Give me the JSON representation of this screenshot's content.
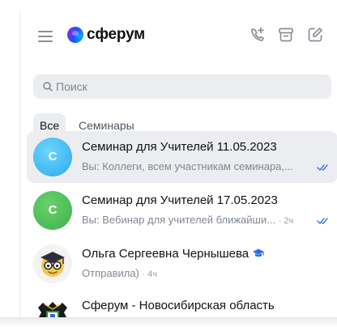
{
  "header": {
    "logo_text": "сферум",
    "brand_color": "#2a5cff"
  },
  "icons": {
    "menu": "hamburger-menu-icon",
    "call": "phone-plus-icon",
    "archive": "archive-icon",
    "compose": "compose-icon",
    "search": "search-icon",
    "read": "double-check-icon",
    "verified": "graduation-cap-icon"
  },
  "search": {
    "placeholder": "Поиск",
    "value": ""
  },
  "tabs": [
    {
      "label": "Все",
      "selected": true
    },
    {
      "label": "Семинары",
      "selected": false
    }
  ],
  "chats": [
    {
      "avatar_letter": "С",
      "title": "Семинар для Учителей 11.05.2023",
      "sender": "Вы:",
      "preview": "Коллеги, всем участникам семинара,...",
      "time": "",
      "read": true,
      "active": true
    },
    {
      "avatar_letter": "С",
      "title": "Семинар для Учителей 17.05.2023",
      "sender": "Вы:",
      "preview": "Вебинар для учителей ближайши...",
      "time": "· 2ч",
      "read": true,
      "active": false
    },
    {
      "title": "Ольга Сергеевна Чернышева",
      "preview": "Отправила)",
      "time": "· 4ч",
      "verified": true,
      "active": false
    },
    {
      "title": "Сферум - Новосибирская область",
      "preview": "",
      "time": "",
      "active": false
    }
  ]
}
